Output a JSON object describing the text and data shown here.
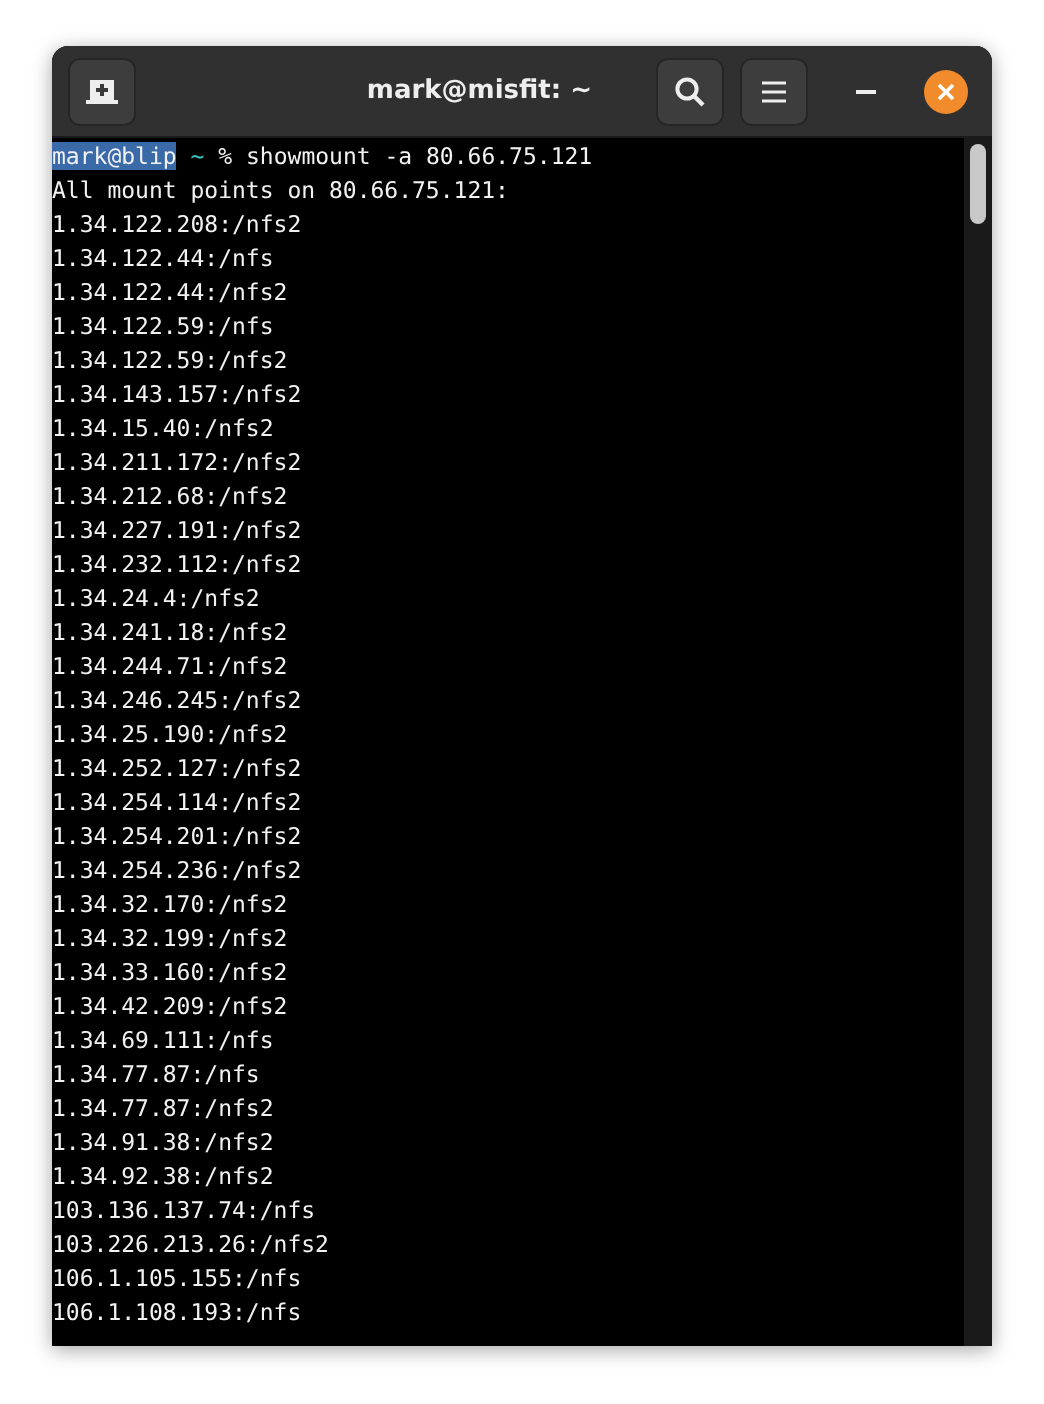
{
  "window": {
    "title": "mark@misfit: ~"
  },
  "header_buttons": [
    {
      "kind": "new-tab"
    },
    {
      "kind": "search"
    },
    {
      "kind": "menu"
    }
  ],
  "window_controls": [
    {
      "kind": "minimize"
    },
    {
      "kind": "close"
    }
  ],
  "terminal": {
    "prompt": {
      "user_host": "mark@blip",
      "selected": true,
      "dir": "~",
      "symbol": "%",
      "command": "showmount -a 80.66.75.121"
    },
    "lines": [
      "All mount points on 80.66.75.121:",
      "1.34.122.208:/nfs2",
      "1.34.122.44:/nfs",
      "1.34.122.44:/nfs2",
      "1.34.122.59:/nfs",
      "1.34.122.59:/nfs2",
      "1.34.143.157:/nfs2",
      "1.34.15.40:/nfs2",
      "1.34.211.172:/nfs2",
      "1.34.212.68:/nfs2",
      "1.34.227.191:/nfs2",
      "1.34.232.112:/nfs2",
      "1.34.24.4:/nfs2",
      "1.34.241.18:/nfs2",
      "1.34.244.71:/nfs2",
      "1.34.246.245:/nfs2",
      "1.34.25.190:/nfs2",
      "1.34.252.127:/nfs2",
      "1.34.254.114:/nfs2",
      "1.34.254.201:/nfs2",
      "1.34.254.236:/nfs2",
      "1.34.32.170:/nfs2",
      "1.34.32.199:/nfs2",
      "1.34.33.160:/nfs2",
      "1.34.42.209:/nfs2",
      "1.34.69.111:/nfs",
      "1.34.77.87:/nfs",
      "1.34.77.87:/nfs2",
      "1.34.91.38:/nfs2",
      "1.34.92.38:/nfs2",
      "103.136.137.74:/nfs",
      "103.226.213.26:/nfs2",
      "106.1.105.155:/nfs",
      "106.1.108.193:/nfs"
    ]
  }
}
